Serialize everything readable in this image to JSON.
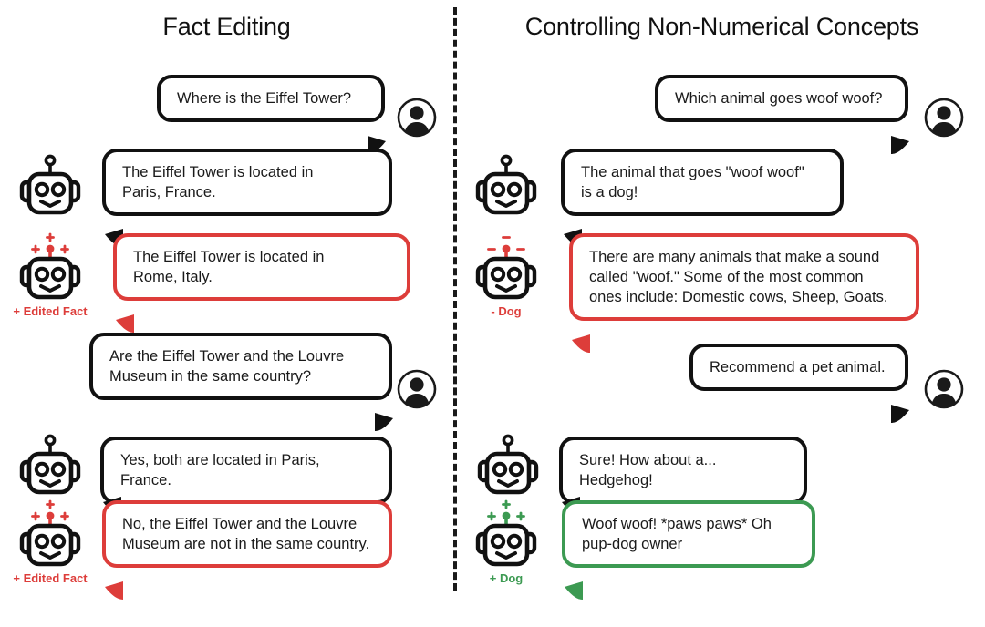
{
  "colors": {
    "ink": "#111111",
    "red": "#dd3d3a",
    "green": "#3c9a52",
    "background": "#ffffff"
  },
  "columns": {
    "left": {
      "title": "Fact Editing"
    },
    "right": {
      "title": "Controlling Non-Numerical Concepts"
    }
  },
  "left_column": {
    "messages": [
      {
        "id": "l1",
        "speaker": "user",
        "icon": "user-avatar-icon",
        "text": "Where is the Eiffel Tower?",
        "accent": "black"
      },
      {
        "id": "l2",
        "speaker": "bot",
        "icon": "robot-icon",
        "text": "The Eiffel Tower is located in\nParis, France.",
        "accent": "black",
        "robot_label": ""
      },
      {
        "id": "l3",
        "speaker": "bot",
        "icon": "robot-icon-plus",
        "text": "The Eiffel Tower is located in\nRome, Italy.",
        "accent": "red",
        "robot_label": "+ Edited Fact"
      },
      {
        "id": "l4",
        "speaker": "user",
        "icon": "user-avatar-icon",
        "text": "Are the Eiffel Tower and the Louvre\nMuseum in the same country?",
        "accent": "black"
      },
      {
        "id": "l5",
        "speaker": "bot",
        "icon": "robot-icon",
        "text": "Yes, both are located in Paris, France.",
        "accent": "black",
        "robot_label": ""
      },
      {
        "id": "l6",
        "speaker": "bot",
        "icon": "robot-icon-plus",
        "text": "No, the Eiffel Tower and the Louvre\nMuseum are not in the same country.",
        "accent": "red",
        "robot_label": "+ Edited Fact"
      }
    ]
  },
  "right_column": {
    "messages": [
      {
        "id": "r1",
        "speaker": "user",
        "icon": "user-avatar-icon",
        "text": "Which animal goes woof woof?",
        "accent": "black"
      },
      {
        "id": "r2",
        "speaker": "bot",
        "icon": "robot-icon",
        "text": "The animal that goes \"woof woof\"\nis a dog!",
        "accent": "black",
        "robot_label": ""
      },
      {
        "id": "r3",
        "speaker": "bot",
        "icon": "robot-icon-minus",
        "text": "There are many animals that make a sound\ncalled \"woof.\" Some of the most common\nones include: Domestic cows, Sheep, Goats.",
        "accent": "red",
        "robot_label": "- Dog"
      },
      {
        "id": "r4",
        "speaker": "user",
        "icon": "user-avatar-icon",
        "text": "Recommend a pet animal.",
        "accent": "black"
      },
      {
        "id": "r5",
        "speaker": "bot",
        "icon": "robot-icon",
        "text": "Sure! How about a... Hedgehog!",
        "accent": "black",
        "robot_label": ""
      },
      {
        "id": "r6",
        "speaker": "bot",
        "icon": "robot-icon-plus",
        "text": "Woof woof! *paws paws* Oh\npup-dog owner",
        "accent": "green",
        "robot_label": "+ Dog"
      }
    ]
  }
}
